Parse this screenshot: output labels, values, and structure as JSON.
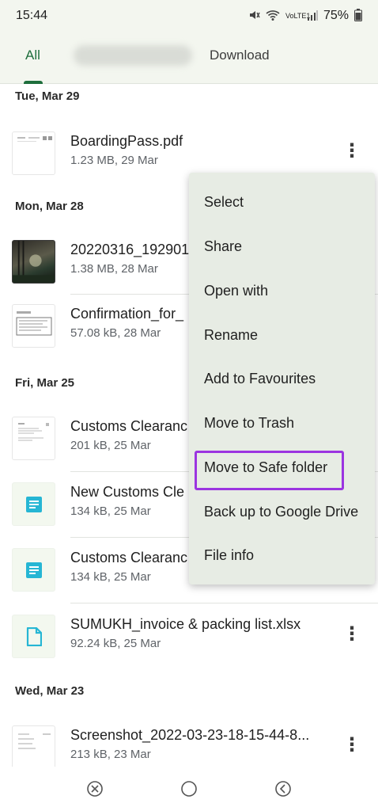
{
  "status_bar": {
    "time": "15:44",
    "network_label": "VoLTE1",
    "battery": "75%"
  },
  "tabs": [
    {
      "label": "All",
      "active": true
    },
    {
      "label": "",
      "blurred": true
    },
    {
      "label": "Download",
      "active": false
    }
  ],
  "sections": [
    {
      "date": "Tue, Mar 29"
    },
    {
      "date": "Mon, Mar 28"
    },
    {
      "date": "Fri, Mar 25"
    },
    {
      "date": "Wed, Mar 23"
    }
  ],
  "files": [
    {
      "name": "BoardingPass.pdf",
      "meta": "1.23 MB, 29 Mar",
      "thumb": "pdf"
    },
    {
      "name": "20220316_192901.",
      "meta": "1.38 MB, 28 Mar",
      "thumb": "photo"
    },
    {
      "name": "Confirmation_for_",
      "meta": "57.08 kB, 28 Mar",
      "thumb": "document"
    },
    {
      "name": "Customs Clearanc",
      "meta": "201 kB, 25 Mar",
      "thumb": "document"
    },
    {
      "name": "New Customs Cle",
      "meta": "134 kB, 25 Mar",
      "thumb": "doc-icon"
    },
    {
      "name": "Customs Clearanc",
      "meta": "134 kB, 25 Mar",
      "thumb": "doc-icon"
    },
    {
      "name": "SUMUKH_invoice & packing list.xlsx",
      "meta": "92.24 kB, 25 Mar",
      "thumb": "file-icon"
    },
    {
      "name": "Screenshot_2022-03-23-18-15-44-8...",
      "meta": "213 kB, 23 Mar",
      "thumb": "screenshot"
    }
  ],
  "menu": {
    "items": [
      "Select",
      "Share",
      "Open with",
      "Rename",
      "Add to Favourites",
      "Move to Trash",
      "Move to Safe folder",
      "Back up to Google Drive",
      "File info"
    ],
    "highlighted": "Move to Safe folder",
    "highlight_color": "#9b35e0"
  },
  "colors": {
    "accent": "#1e6e3c",
    "doc_icon": "#26b6d4",
    "menu_bg": "#e7ece4"
  }
}
